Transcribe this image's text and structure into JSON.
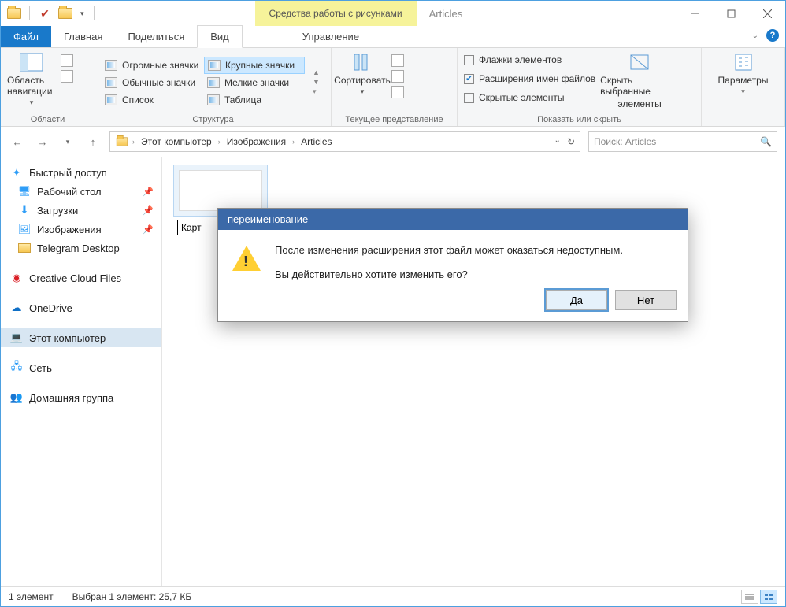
{
  "window": {
    "context_tools_label": "Средства работы с рисунками",
    "title": "Articles"
  },
  "tabs": {
    "file": "Файл",
    "home": "Главная",
    "share": "Поделиться",
    "view": "Вид",
    "manage": "Управление"
  },
  "ribbon": {
    "groups": {
      "areas": {
        "label": "Области",
        "nav_pane": "Область навигации"
      },
      "layout": {
        "label": "Структура",
        "items": {
          "huge": "Огромные значки",
          "large": "Крупные значки",
          "regular": "Обычные значки",
          "small": "Мелкие значки",
          "list": "Список",
          "table": "Таблица"
        }
      },
      "current_view": {
        "label": "Текущее представление",
        "sort": "Сортировать"
      },
      "show_hide": {
        "label": "Показать или скрыть",
        "flags": "Флажки элементов",
        "extensions": "Расширения имен файлов",
        "hidden": "Скрытые элементы",
        "hide_selected_l1": "Скрыть выбранные",
        "hide_selected_l2": "элементы"
      },
      "options": {
        "label": "Параметры"
      }
    }
  },
  "breadcrumb": {
    "items": [
      "Этот компьютер",
      "Изображения",
      "Articles"
    ]
  },
  "search": {
    "placeholder": "Поиск: Articles"
  },
  "sidebar": {
    "quick_access": "Быстрый доступ",
    "items": [
      {
        "label": "Рабочий стол",
        "pinned": true,
        "icon": "desktop"
      },
      {
        "label": "Загрузки",
        "pinned": true,
        "icon": "downloads"
      },
      {
        "label": "Изображения",
        "pinned": true,
        "icon": "pictures"
      },
      {
        "label": "Telegram Desktop",
        "pinned": false,
        "icon": "folder"
      }
    ],
    "creative_cloud": "Creative Cloud Files",
    "onedrive": "OneDrive",
    "this_pc": "Этот компьютер",
    "network": "Сеть",
    "homegroup": "Домашняя группа"
  },
  "file_item": {
    "rename_value": "Карт"
  },
  "dialog": {
    "title": "переименование",
    "line1": "После изменения расширения этот файл может оказаться недоступным.",
    "line2": "Вы действительно хотите изменить его?",
    "yes": "а",
    "yes_ul": "Д",
    "no": "ет",
    "no_ul": "Н"
  },
  "status": {
    "count": "1 элемент",
    "selection": "Выбран 1 элемент: 25,7 КБ"
  }
}
